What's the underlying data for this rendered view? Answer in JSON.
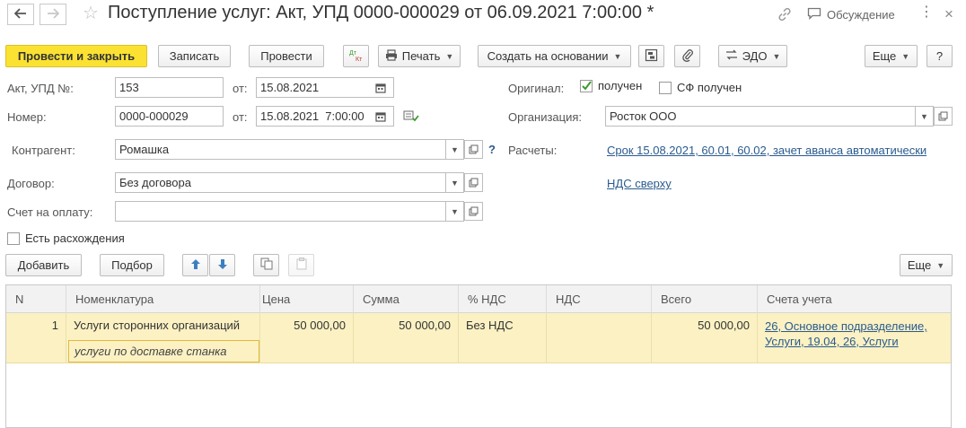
{
  "window": {
    "title": "Поступление услуг: Акт, УПД 0000-000029 от 06.09.2021 7:00:00 *",
    "discussion": "Обсуждение"
  },
  "toolbar": {
    "post_close": "Провести и закрыть",
    "save": "Записать",
    "post": "Провести",
    "dtkt": "Дт Кт",
    "print": "Печать",
    "create_based": "Создать на основании",
    "edo": "ЭДО",
    "more": "Еще",
    "help": "?"
  },
  "form": {
    "act_label": "Акт, УПД №:",
    "act_value": "153",
    "from_label": "от:",
    "act_date": "15.08.2021",
    "number_label": "Номер:",
    "number_value": "0000-000029",
    "number_date": "15.08.2021  7:00:00",
    "original_label": "Оригинал:",
    "received_label": "получен",
    "received_checked": true,
    "sf_received_label": "СФ получен",
    "sf_received_checked": false,
    "org_label": "Организация:",
    "org_value": "Росток ООО",
    "contractor_label": "Контрагент:",
    "contractor_value": "Ромашка",
    "help_mark": "?",
    "settlements_label": "Расчеты:",
    "settlements_link": "Срок 15.08.2021, 60.01, 60.02, зачет аванса автоматически",
    "contract_label": "Договор:",
    "contract_value": "Без договора",
    "vat_link": "НДС сверху",
    "invoice_label": "Счет на оплату:",
    "invoice_value": "",
    "discrepancy_label": "Есть расхождения",
    "discrepancy_checked": false
  },
  "table_toolbar": {
    "add": "Добавить",
    "select": "Подбор",
    "more": "Еще"
  },
  "table": {
    "columns": [
      "N",
      "Номенклатура",
      "Цена",
      "Сумма",
      "% НДС",
      "НДС",
      "Всего",
      "Счета учета"
    ],
    "rows": [
      {
        "n": "1",
        "item": "Услуги сторонних организаций",
        "content": "услуги по доставке станка",
        "price": "50 000,00",
        "sum": "50 000,00",
        "vat_rate": "Без НДС",
        "vat": "",
        "total": "50 000,00",
        "accounts_line1": "26, Основное подразделение,",
        "accounts_line2": "Услуги, 19.04, 26, Услуги"
      }
    ]
  },
  "colors": {
    "accent": "#fbe232",
    "row_highlight": "#fbf1c3",
    "link": "#2a5b8f",
    "check": "#3b9a2e"
  }
}
